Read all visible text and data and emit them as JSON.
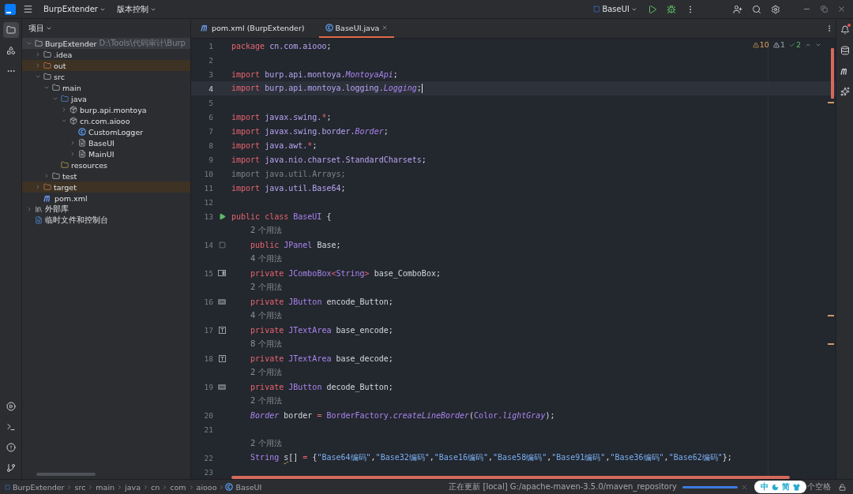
{
  "title_bar": {
    "project": "BurpExtender",
    "vcs": "版本控制",
    "run_config": "BaseUI"
  },
  "project_panel": {
    "title": "项目",
    "tree": [
      {
        "label": "BurpExtender",
        "hint": "D:\\Tools\\代码审计\\Burp",
        "kind": "module",
        "expanded": true,
        "selected": true,
        "excluded": false,
        "children": [
          {
            "label": ".idea",
            "kind": "folder",
            "expanded": false,
            "selected": false,
            "excluded": false
          },
          {
            "label": "out",
            "kind": "folder-excluded",
            "expanded": false,
            "selected": false,
            "excluded": true
          },
          {
            "label": "src",
            "kind": "folder",
            "expanded": true,
            "selected": false,
            "excluded": false,
            "children": [
              {
                "label": "main",
                "kind": "folder",
                "expanded": true,
                "selected": false,
                "excluded": false,
                "children": [
                  {
                    "label": "java",
                    "kind": "source-root",
                    "expanded": true,
                    "selected": false,
                    "excluded": false,
                    "children": [
                      {
                        "label": "burp.api.montoya",
                        "kind": "package",
                        "expanded": false,
                        "selected": false,
                        "excluded": false
                      },
                      {
                        "label": "cn.com.aiooo",
                        "kind": "package",
                        "expanded": true,
                        "selected": false,
                        "excluded": false,
                        "children": [
                          {
                            "label": "CustomLogger",
                            "kind": "class",
                            "selected": false,
                            "excluded": false
                          },
                          {
                            "label": "BaseUI",
                            "kind": "form",
                            "expanded": false,
                            "selected": false,
                            "excluded": false
                          },
                          {
                            "label": "MainUI",
                            "kind": "form",
                            "expanded": false,
                            "selected": false,
                            "excluded": false
                          }
                        ]
                      }
                    ]
                  },
                  {
                    "label": "resources",
                    "kind": "resources",
                    "selected": false,
                    "excluded": false
                  }
                ]
              },
              {
                "label": "test",
                "kind": "folder",
                "expanded": false,
                "selected": false,
                "excluded": false
              }
            ]
          },
          {
            "label": "target",
            "kind": "folder-excluded",
            "expanded": false,
            "selected": false,
            "excluded": true
          },
          {
            "label": "pom.xml",
            "kind": "maven",
            "selected": false,
            "excluded": false
          }
        ]
      },
      {
        "label": "外部库",
        "kind": "library",
        "expanded": false,
        "selected": false,
        "excluded": false
      },
      {
        "label": "临时文件和控制台",
        "kind": "scratch",
        "selected": false,
        "excluded": false
      }
    ]
  },
  "tabs": [
    {
      "label": "pom.xml (BurpExtender)",
      "kind": "maven",
      "selected": false,
      "closable": false
    },
    {
      "label": "BaseUI.java",
      "kind": "class",
      "selected": true,
      "closable": true
    }
  ],
  "inspections": [
    {
      "kind": "warning",
      "count": "10"
    },
    {
      "kind": "weak",
      "count": "1"
    },
    {
      "kind": "ok",
      "count": "2"
    }
  ],
  "code": [
    {
      "number": "1",
      "current": false,
      "tokens": [
        {
          "t": "package",
          "kind": "kw"
        },
        {
          "t": " cn.com.aiooo",
          "kind": "pkg"
        },
        {
          "t": ";",
          "kind": "plain"
        }
      ]
    },
    {
      "number": "2",
      "current": false
    },
    {
      "number": "3",
      "current": false,
      "tokens": [
        {
          "t": "import",
          "kind": "kw"
        },
        {
          "t": " burp.api.montoya.",
          "kind": "pkg"
        },
        {
          "t": "MontoyaApi",
          "kind": "italic"
        },
        {
          "t": ";",
          "kind": "plain"
        }
      ]
    },
    {
      "number": "4",
      "current": true,
      "tokens": [
        {
          "t": "import",
          "kind": "kw"
        },
        {
          "t": " burp.api.montoya.logging.",
          "kind": "pkg"
        },
        {
          "t": "Logging",
          "kind": "italic"
        },
        {
          "t": ";",
          "kind": "plain"
        }
      ]
    },
    {
      "number": "5",
      "current": false
    },
    {
      "number": "6",
      "current": false,
      "tokens": [
        {
          "t": "import",
          "kind": "kw"
        },
        {
          "t": " javax.swing.",
          "kind": "pkg"
        },
        {
          "t": "*",
          "kind": "op"
        },
        {
          "t": ";",
          "kind": "plain"
        }
      ]
    },
    {
      "number": "7",
      "current": false,
      "tokens": [
        {
          "t": "import",
          "kind": "kw"
        },
        {
          "t": " javax.swing.border.",
          "kind": "pkg"
        },
        {
          "t": "Border",
          "kind": "italic"
        },
        {
          "t": ";",
          "kind": "plain"
        }
      ]
    },
    {
      "number": "8",
      "current": false,
      "tokens": [
        {
          "t": "import",
          "kind": "kw"
        },
        {
          "t": " java.awt.",
          "kind": "pkg"
        },
        {
          "t": "*",
          "kind": "op"
        },
        {
          "t": ";",
          "kind": "plain"
        }
      ]
    },
    {
      "number": "9",
      "current": false,
      "tokens": [
        {
          "t": "import",
          "kind": "kw"
        },
        {
          "t": " java.nio.charset.StandardCharsets",
          "kind": "pkg"
        },
        {
          "t": ";",
          "kind": "plain"
        }
      ]
    },
    {
      "number": "10",
      "current": false,
      "tokens": [
        {
          "t": "import java.util.Arrays;",
          "kind": "dim"
        }
      ]
    },
    {
      "number": "11",
      "current": false,
      "tokens": [
        {
          "t": "import",
          "kind": "kw"
        },
        {
          "t": " java.util.Base64",
          "kind": "pkg"
        },
        {
          "t": ";",
          "kind": "plain"
        }
      ]
    },
    {
      "number": "12",
      "current": false
    },
    {
      "number": "13",
      "current": false,
      "gutter": {
        "kind": "run"
      },
      "tokens": [
        {
          "t": "public class",
          "kind": "kw"
        },
        {
          "t": " BaseUI",
          "kind": "type"
        },
        {
          "t": " {",
          "kind": "plain"
        }
      ]
    },
    {
      "number": "14",
      "current": false,
      "gutter": {
        "kind": "panel"
      },
      "usages": "2 个用法",
      "tokens": [
        {
          "t": "    public",
          "kind": "kw"
        },
        {
          "t": " JPanel",
          "kind": "type"
        },
        {
          "t": " Base;",
          "kind": "plain"
        }
      ]
    },
    {
      "number": "15",
      "current": false,
      "gutter": {
        "kind": "combo"
      },
      "usages": "4 个用法",
      "tokens": [
        {
          "t": "    private",
          "kind": "kw"
        },
        {
          "t": " JComboBox",
          "kind": "type"
        },
        {
          "t": "<",
          "kind": "op"
        },
        {
          "t": "String",
          "kind": "type"
        },
        {
          "t": ">",
          "kind": "op"
        },
        {
          "t": " base_ComboBox;",
          "kind": "plain"
        }
      ]
    },
    {
      "number": "16",
      "current": false,
      "gutter": {
        "kind": "button"
      },
      "usages": "2 个用法",
      "tokens": [
        {
          "t": "    private",
          "kind": "kw"
        },
        {
          "t": " JButton",
          "kind": "type"
        },
        {
          "t": " encode_Button;",
          "kind": "plain"
        }
      ]
    },
    {
      "number": "17",
      "current": false,
      "gutter": {
        "kind": "textarea"
      },
      "usages": "4 个用法",
      "tokens": [
        {
          "t": "    private",
          "kind": "kw"
        },
        {
          "t": " JTextArea",
          "kind": "type"
        },
        {
          "t": " base_encode;",
          "kind": "plain"
        }
      ]
    },
    {
      "number": "18",
      "current": false,
      "gutter": {
        "kind": "textarea"
      },
      "usages": "8 个用法",
      "tokens": [
        {
          "t": "    private",
          "kind": "kw"
        },
        {
          "t": " JTextArea",
          "kind": "type"
        },
        {
          "t": " base_decode;",
          "kind": "plain"
        }
      ]
    },
    {
      "number": "19",
      "current": false,
      "gutter": {
        "kind": "button"
      },
      "usages": "2 个用法",
      "tokens": [
        {
          "t": "    private",
          "kind": "kw"
        },
        {
          "t": " JButton",
          "kind": "type"
        },
        {
          "t": " decode_Button;",
          "kind": "plain"
        }
      ]
    },
    {
      "number": "20",
      "current": false,
      "usages": "2 个用法",
      "tokens": [
        {
          "t": "    Border",
          "kind": "italic"
        },
        {
          "t": " border ",
          "kind": "plain"
        },
        {
          "t": "=",
          "kind": "op"
        },
        {
          "t": " BorderFactory.",
          "kind": "type"
        },
        {
          "t": "createLineBorder",
          "kind": "italic"
        },
        {
          "t": "(",
          "kind": "plain"
        },
        {
          "t": "Color.",
          "kind": "type"
        },
        {
          "t": "lightGray",
          "kind": "italic"
        },
        {
          "t": ");",
          "kind": "plain"
        }
      ]
    },
    {
      "number": "21",
      "current": false
    },
    {
      "number": "22",
      "current": false,
      "usages": "2 个用法",
      "tokens": [
        {
          "t": "    String ",
          "kind": "type"
        },
        {
          "t": "s",
          "kind": "warn"
        },
        {
          "t": "[] ",
          "kind": "plain"
        },
        {
          "t": "=",
          "kind": "op"
        },
        {
          "t": " {",
          "kind": "plain"
        },
        {
          "t": "\"Base64编码\"",
          "kind": "str"
        },
        {
          "t": ",",
          "kind": "plain"
        },
        {
          "t": "\"Base32编码\"",
          "kind": "str"
        },
        {
          "t": ",",
          "kind": "plain"
        },
        {
          "t": "\"Base16编码\"",
          "kind": "str"
        },
        {
          "t": ",",
          "kind": "plain"
        },
        {
          "t": "\"Base58编码\"",
          "kind": "str"
        },
        {
          "t": ",",
          "kind": "plain"
        },
        {
          "t": "\"Base91编码\"",
          "kind": "str"
        },
        {
          "t": ",",
          "kind": "plain"
        },
        {
          "t": "\"Base36编码\"",
          "kind": "str"
        },
        {
          "t": ",",
          "kind": "plain"
        },
        {
          "t": "\"Base62编码\"",
          "kind": "str"
        },
        {
          "t": "};",
          "kind": "plain"
        }
      ]
    },
    {
      "number": "23",
      "current": false
    }
  ],
  "status_bar": {
    "breadcrumbs": [
      "BurpExtender",
      "src",
      "main",
      "java",
      "cn",
      "com",
      "aiooo",
      "BaseUI"
    ],
    "task": "正在更新 [local] G:/apache-maven-3.5.0/maven_repository",
    "task_progress": {
      "level": 1
    },
    "ime": [
      "中",
      "简"
    ],
    "indent": "个空格"
  }
}
